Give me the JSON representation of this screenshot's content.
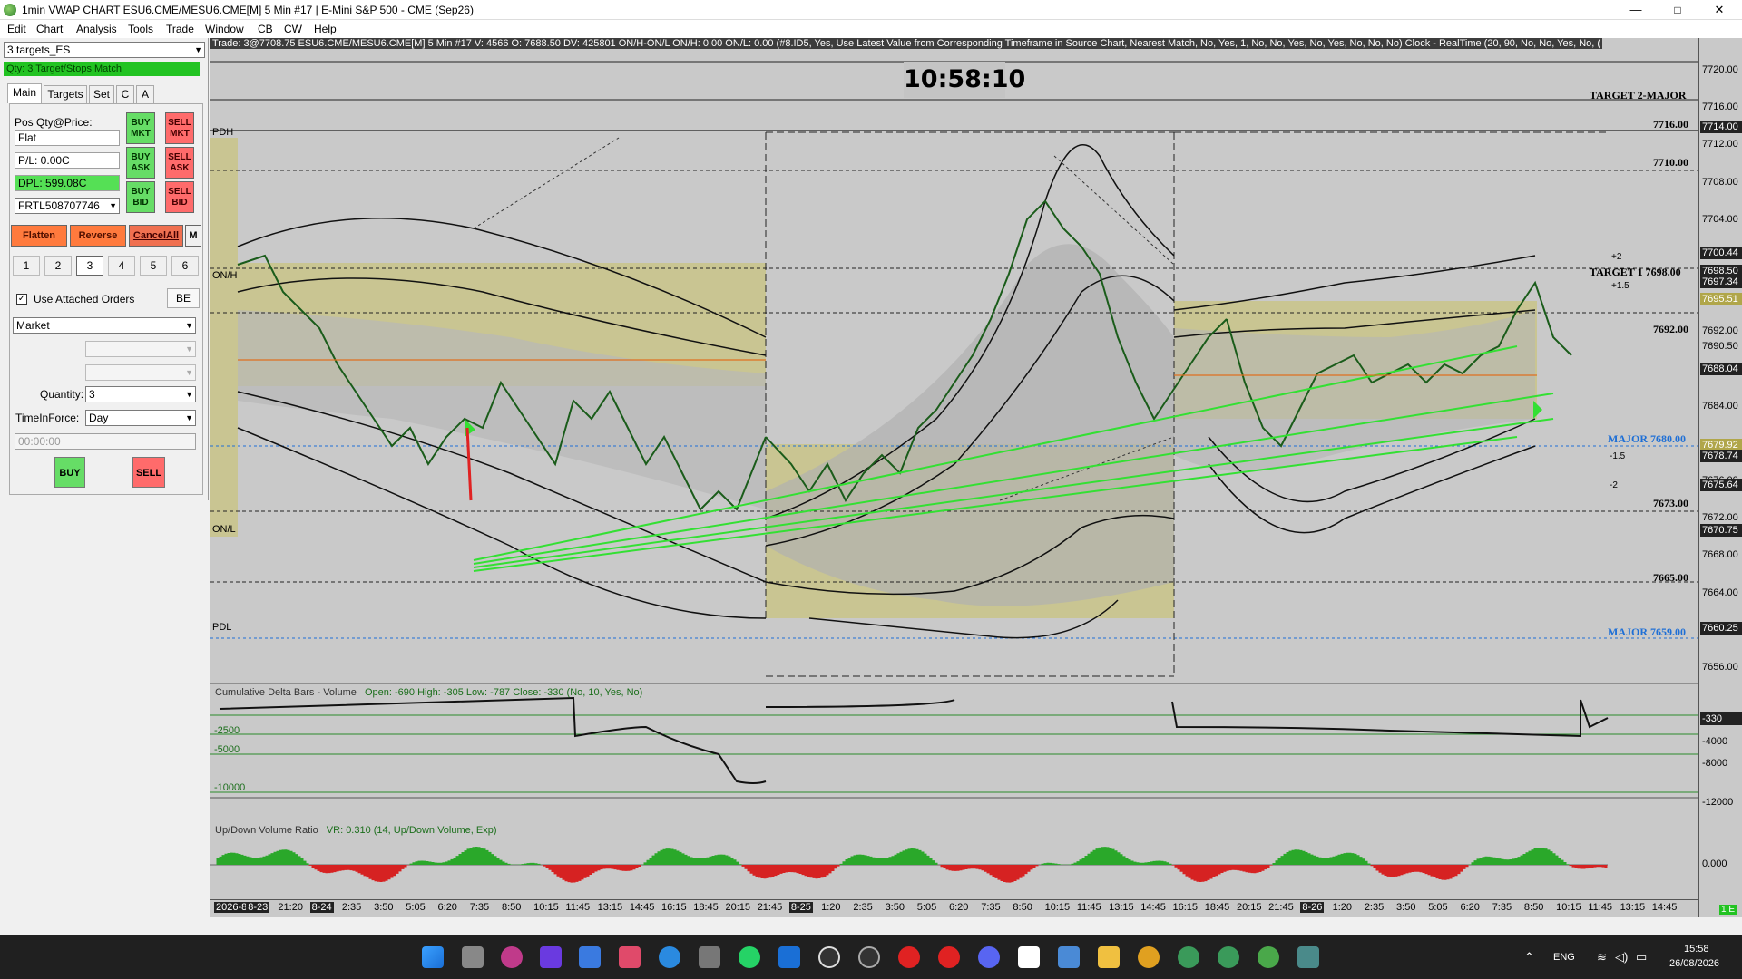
{
  "window": {
    "title": "1min VWAP CHART ESU6.CME/MESU6.CME[M]  5 Min  #17 | E-Mini S&P 500 - CME (Sep26)",
    "minimize": "—",
    "maximize": "□",
    "close": "✕"
  },
  "menu": [
    "Edit",
    "Chart",
    "Analysis",
    "Tools",
    "Trade",
    "Window",
    "CB",
    "CW",
    "Help"
  ],
  "trade_panel": {
    "target_preset": "3 targets_ES",
    "status": "Qty: 3 Target/Stops Match",
    "tabs": [
      "Main",
      "Targets",
      "Set",
      "C",
      "A"
    ],
    "pos_label": "Pos Qty@Price:",
    "pos_value": "Flat",
    "pl_value": "P/L: 0.00C",
    "dpl_value": "DPL: 599.08C",
    "account": "FRTL508707746",
    "buy_mkt": "BUY MKT",
    "sell_mkt": "SELL MKT",
    "buy_ask": "BUY ASK",
    "sell_ask": "SELL ASK",
    "buy_bid": "BUY BID",
    "sell_bid": "SELL BID",
    "flatten": "Flatten",
    "reverse": "Reverse",
    "cancel_all": "CancelAll",
    "m": "M",
    "numbers": [
      "1",
      "2",
      "3",
      "4",
      "5",
      "6"
    ],
    "use_attached": "Use Attached Orders",
    "be": "BE",
    "order_type": "Market",
    "quantity_label": "Quantity:",
    "quantity": "3",
    "tif_label": "TimeInForce:",
    "tif": "Day",
    "time_field": "00:00:00",
    "buy": "BUY",
    "sell": "SELL"
  },
  "chart": {
    "status_line": "Trade: 3@7708.75  ESU6.CME/MESU6.CME[M]  5 Min  #17  V: 4566  O: 7688.50  DV: 425801  ON/H-ON/L  ON/H: 0.00  ON/L: 0.00  (#8.ID5, Yes, Use Latest Value from Corresponding Timeframe in Source Chart, Nearest Match, No, Yes, 1, No, No, Yes, No, Yes, No, No, No)  Clock - RealTime  (20, 90, No, No, Yes, No, (",
    "clock": "10:58:10",
    "target2": "TARGET 2-MAJOR",
    "target1": "TARGET 1  7698.00",
    "major_7680": "MAJOR  7680.00",
    "major_7659": "MAJOR  7659.00",
    "pdh": "PDH",
    "onh": "ON/H",
    "onl": "ON/L",
    "pdl": "PDL",
    "levels": [
      {
        "price": "7716.00"
      },
      {
        "price": "7710.00"
      },
      {
        "price": "7692.00"
      },
      {
        "price": "7673.00"
      },
      {
        "price": "7665.00"
      }
    ],
    "band_marks": [
      "+2",
      "+1.5",
      "-1.5",
      "-2"
    ],
    "axis_labels": [
      "7720.00",
      "7716.00",
      "7712.00",
      "7708.00",
      "7704.00",
      "7700.00",
      "7692.00",
      "7688.00",
      "7684.00",
      "7680.00",
      "7676.00",
      "7672.00",
      "7668.00",
      "7664.00",
      "7660.00",
      "7656.00"
    ],
    "price_boxes": [
      {
        "label": "7714.00",
        "bg": "#222222",
        "fg": "#ffffff"
      },
      {
        "label": "7700.44",
        "bg": "#222222",
        "fg": "#ffffff"
      },
      {
        "label": "7698.50",
        "bg": "#222222",
        "fg": "#ffffff"
      },
      {
        "label": "7697.34",
        "bg": "#222222",
        "fg": "#ffffff"
      },
      {
        "label": "7695.51",
        "bg": "#b0a64a",
        "fg": "#ffffff"
      },
      {
        "label": "7690.50",
        "bg": "#c9c9c9",
        "fg": "#000000"
      },
      {
        "label": "7688.04",
        "bg": "#222222",
        "fg": "#ffffff"
      },
      {
        "label": "7679.92",
        "bg": "#b0a64a",
        "fg": "#ffffff"
      },
      {
        "label": "7678.74",
        "bg": "#222222",
        "fg": "#ffffff"
      },
      {
        "label": "7675.64",
        "bg": "#222222",
        "fg": "#ffffff"
      },
      {
        "label": "7670.75",
        "bg": "#222222",
        "fg": "#ffffff"
      },
      {
        "label": "7660.25",
        "bg": "#222222",
        "fg": "#ffffff"
      }
    ],
    "cum_delta_title": "Cumulative Delta Bars - Volume",
    "cum_delta_stats": "Open: -690  High: -305  Low: -787  Close: -330  (No, 10, Yes, No)",
    "cum_delta_levels": [
      "-2500",
      "-5000",
      "-10000"
    ],
    "cum_delta_axis": [
      "-330",
      "-4000",
      "-8000",
      "-12000"
    ],
    "vr_title": "Up/Down Volume Ratio",
    "vr_stats": "VR: 0.310  (14, Up/Down Volume, Exp)",
    "vr_axis": "0.000",
    "time_labels": [
      {
        "t": "2026-8-21",
        "date": true
      },
      {
        "t": "8-23",
        "date": true
      },
      {
        "t": "21:20"
      },
      {
        "t": "8-24",
        "date": true
      },
      {
        "t": "2:35"
      },
      {
        "t": "3:50"
      },
      {
        "t": "5:05"
      },
      {
        "t": "6:20"
      },
      {
        "t": "7:35"
      },
      {
        "t": "8:50"
      },
      {
        "t": "10:15"
      },
      {
        "t": "11:45"
      },
      {
        "t": "13:15"
      },
      {
        "t": "14:45"
      },
      {
        "t": "16:15"
      },
      {
        "t": "18:45"
      },
      {
        "t": "20:15"
      },
      {
        "t": "21:45"
      },
      {
        "t": "8-25",
        "date": true
      },
      {
        "t": "1:20"
      },
      {
        "t": "2:35"
      },
      {
        "t": "3:50"
      },
      {
        "t": "5:05"
      },
      {
        "t": "6:20"
      },
      {
        "t": "7:35"
      },
      {
        "t": "8:50"
      },
      {
        "t": "10:15"
      },
      {
        "t": "11:45"
      },
      {
        "t": "13:15"
      },
      {
        "t": "14:45"
      },
      {
        "t": "16:15"
      },
      {
        "t": "18:45"
      },
      {
        "t": "20:15"
      },
      {
        "t": "21:45"
      },
      {
        "t": "8-26",
        "date": true
      },
      {
        "t": "1:20"
      },
      {
        "t": "2:35"
      },
      {
        "t": "3:50"
      },
      {
        "t": "5:05"
      },
      {
        "t": "6:20"
      },
      {
        "t": "7:35"
      },
      {
        "t": "8:50"
      },
      {
        "t": "10:15"
      },
      {
        "t": "11:45"
      },
      {
        "t": "13:15"
      },
      {
        "t": "14:45"
      }
    ],
    "corner_tag": "1 E"
  },
  "taskbar": {
    "lang": "ENG",
    "time": "15:58",
    "date": "26/08/2026"
  }
}
